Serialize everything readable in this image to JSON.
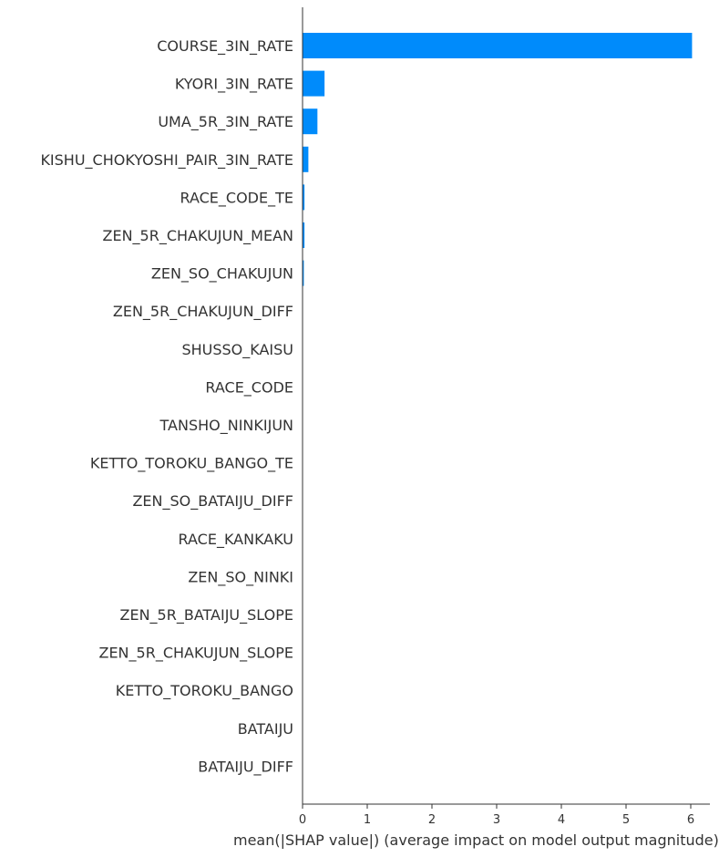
{
  "chart_data": {
    "type": "bar",
    "orientation": "horizontal",
    "categories": [
      "COURSE_3IN_RATE",
      "KYORI_3IN_RATE",
      "UMA_5R_3IN_RATE",
      "KISHU_CHOKYOSHI_PAIR_3IN_RATE",
      "RACE_CODE_TE",
      "ZEN_5R_CHAKUJUN_MEAN",
      "ZEN_SO_CHAKUJUN",
      "ZEN_5R_CHAKUJUN_DIFF",
      "SHUSSO_KAISU",
      "RACE_CODE",
      "TANSHO_NINKIJUN",
      "KETTO_TOROKU_BANGO_TE",
      "ZEN_SO_BATAIJU_DIFF",
      "RACE_KANKAKU",
      "ZEN_SO_NINKI",
      "ZEN_5R_BATAIJU_SLOPE",
      "ZEN_5R_CHAKUJUN_SLOPE",
      "KETTO_TOROKU_BANGO",
      "BATAIJU",
      "BATAIJU_DIFF"
    ],
    "values": [
      6.02,
      0.34,
      0.23,
      0.09,
      0.03,
      0.03,
      0.02,
      0.005,
      0.004,
      0.003,
      0.003,
      0.002,
      0.002,
      0.002,
      0.001,
      0.001,
      0.001,
      0.001,
      0.001,
      0.0
    ],
    "xlabel": "mean(|SHAP value|) (average impact on model output magnitude)",
    "ylabel": "",
    "title": "",
    "xlim": [
      0,
      6.3
    ],
    "xticks": [
      0,
      1,
      2,
      3,
      4,
      5,
      6
    ],
    "bar_color": "#008bfb",
    "axis_color": "#333333",
    "grid": false,
    "legend": false
  }
}
